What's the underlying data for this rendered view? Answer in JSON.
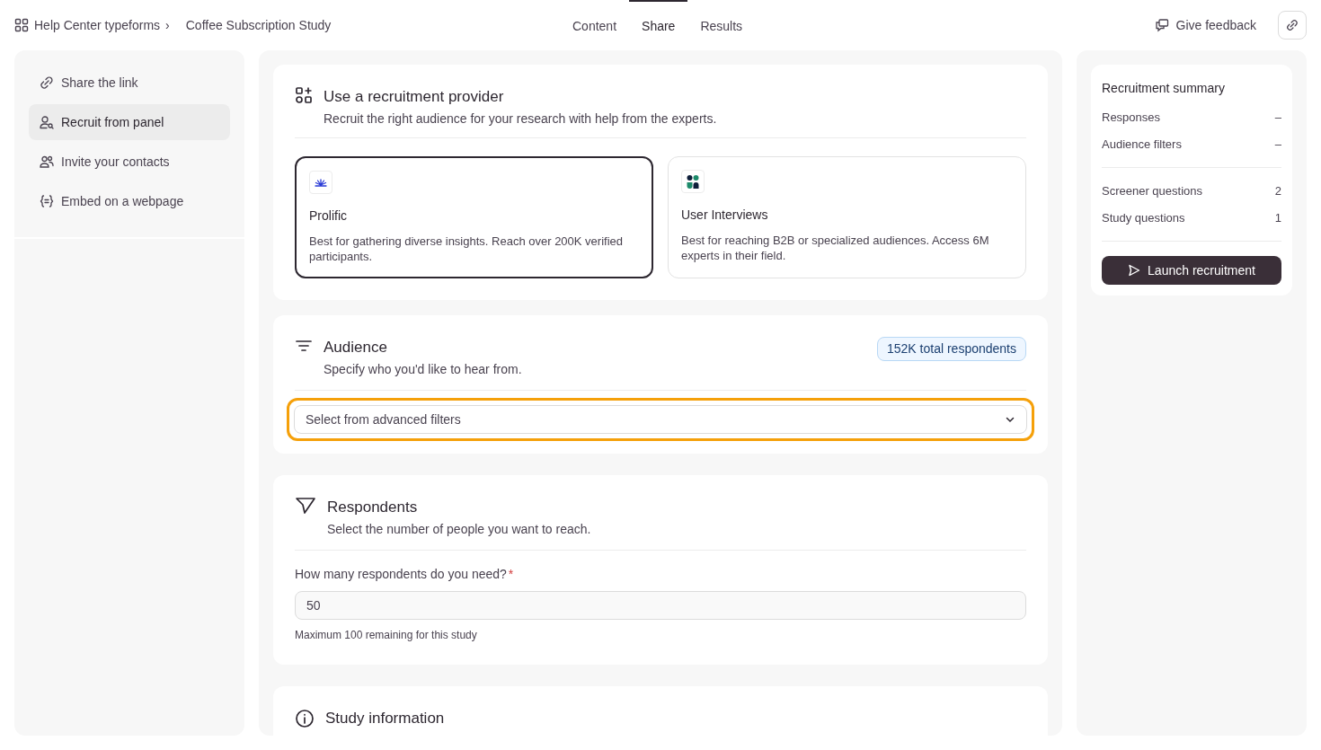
{
  "breadcrumb": {
    "workspace": "Help Center typeforms",
    "separator": "›",
    "current": "Coffee Subscription Study"
  },
  "tabs": [
    {
      "label": "Content",
      "selected": false
    },
    {
      "label": "Share",
      "selected": true
    },
    {
      "label": "Results",
      "selected": false
    }
  ],
  "feedback_button": "Give feedback",
  "sidebar": {
    "items": [
      {
        "label": "Share the link",
        "kind": "link",
        "selected": false
      },
      {
        "label": "Recruit from panel",
        "kind": "panel",
        "selected": true
      },
      {
        "label": "Invite your contacts",
        "kind": "contacts",
        "selected": false
      },
      {
        "label": "Embed on a webpage",
        "kind": "embed",
        "selected": false
      }
    ]
  },
  "provider_section": {
    "title": "Use a recruitment provider",
    "subtitle": "Recruit the right audience for your research with help from the experts.",
    "providers": [
      {
        "name": "Prolific",
        "kind": "prolific",
        "description": "Best for gathering diverse insights. Reach over 200K verified participants.",
        "selected": true
      },
      {
        "name": "User Interviews",
        "kind": "userinterviews",
        "description": "Best for reaching B2B or specialized audiences. Access 6M experts in their field.",
        "selected": false
      }
    ]
  },
  "audience_section": {
    "title": "Audience",
    "subtitle": "Specify who you'd like to hear from.",
    "badge": "152K total respondents",
    "filter_select": {
      "placeholder": "Select from advanced filters",
      "highlighted": true
    }
  },
  "respondents_section": {
    "title": "Respondents",
    "subtitle": "Select the number of people you want to reach.",
    "field": {
      "label": "How many respondents do you need?",
      "required_mark": "*",
      "value": "50",
      "hint": "Maximum 100 remaining for this study"
    }
  },
  "study_section": {
    "title": "Study information"
  },
  "summary": {
    "title": "Recruitment summary",
    "groups": [
      [
        {
          "label": "Responses",
          "value": "–"
        },
        {
          "label": "Audience filters",
          "value": "–"
        }
      ],
      [
        {
          "label": "Screener questions",
          "value": "2"
        },
        {
          "label": "Study questions",
          "value": "1"
        }
      ]
    ],
    "button": "Launch recruitment"
  }
}
